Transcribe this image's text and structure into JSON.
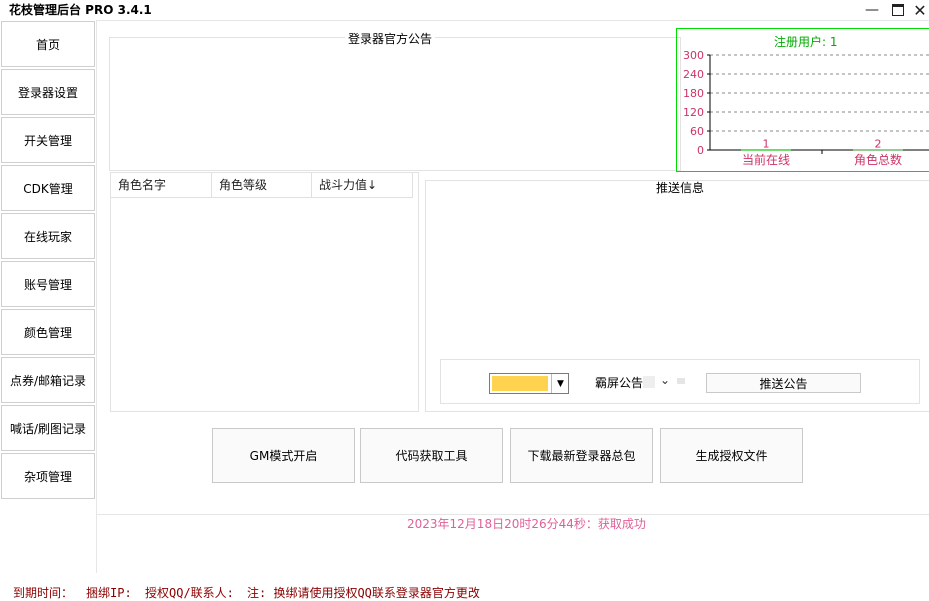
{
  "window": {
    "title": "花枝管理后台 PRO 3.4.1"
  },
  "sidebar": {
    "items": [
      {
        "label": "首页"
      },
      {
        "label": "登录器设置"
      },
      {
        "label": "开关管理"
      },
      {
        "label": "CDK管理"
      },
      {
        "label": "在线玩家"
      },
      {
        "label": "账号管理"
      },
      {
        "label": "颜色管理"
      },
      {
        "label": "点券/邮箱记录"
      },
      {
        "label": "喊话/刷图记录"
      },
      {
        "label": "杂项管理"
      }
    ]
  },
  "announcement": {
    "title": "登录器官方公告"
  },
  "role_table": {
    "columns": [
      "角色名字",
      "角色等级",
      "战斗力值↓"
    ]
  },
  "push": {
    "title": "推送信息",
    "color_swatch": "#ffd24f",
    "type_value": "霸屏公告",
    "push_button": "推送公告"
  },
  "actions": {
    "gm_mode": "GM模式开启",
    "code_tool": "代码获取工具",
    "download": "下载最新登录器总包",
    "gen_license": "生成授权文件"
  },
  "status": {
    "message": "2023年12月18日20时26分44秒：获取成功"
  },
  "footer": {
    "expire": "到期时间：",
    "bind_ip": "捆绑IP:",
    "qq": "授权QQ/联系人:",
    "note": "注: 换绑请使用授权QQ联系登录器官方更改"
  },
  "chart_data": {
    "type": "bar",
    "title": "注册用户: 1",
    "categories": [
      "当前在线",
      "角色总数"
    ],
    "values": [
      1,
      2
    ],
    "ylim": [
      0,
      300
    ],
    "yticks": [
      "0",
      "60",
      "120",
      "180",
      "240",
      "300"
    ],
    "grid": true,
    "colors": {
      "text": "#cc3366",
      "title": "#00aa00",
      "border": "#00dd00"
    }
  }
}
